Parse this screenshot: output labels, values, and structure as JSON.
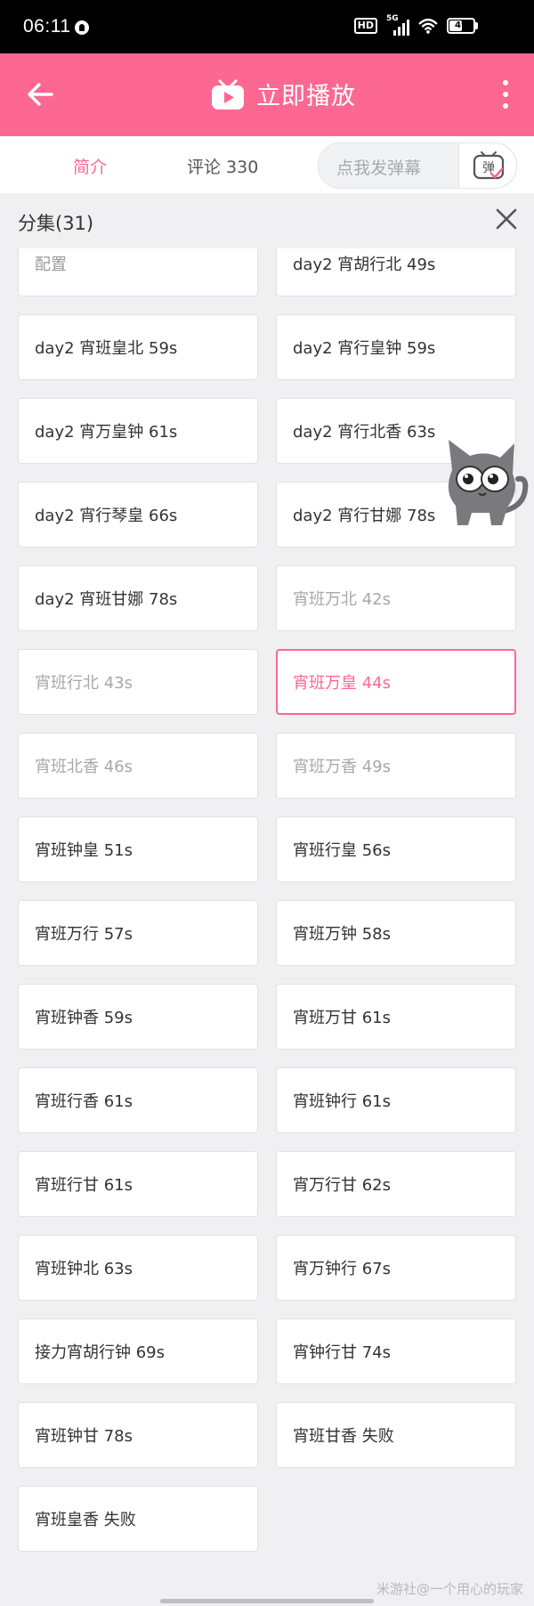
{
  "status_bar": {
    "time": "06:11",
    "hd": "HD",
    "network": "5G",
    "battery": "49",
    "battery_level": 0.49
  },
  "top_bar": {
    "title": "立即播放",
    "color": "#fc6891"
  },
  "tabs": [
    {
      "label": "简介",
      "active": true
    },
    {
      "label": "评论 330",
      "active": false
    }
  ],
  "danmaku": {
    "placeholder": "点我发弹幕",
    "button_glyph": "弹"
  },
  "episode_panel": {
    "title": "分集(31)",
    "episodes": [
      {
        "label": "配置",
        "state": "dim"
      },
      {
        "label": "day2 宵胡行北 49s",
        "state": "normal"
      },
      {
        "label": "day2 宵班皇北 59s",
        "state": "normal"
      },
      {
        "label": "day2 宵行皇钟 59s",
        "state": "normal"
      },
      {
        "label": "day2 宵万皇钟 61s",
        "state": "normal"
      },
      {
        "label": "day2 宵行北香 63s",
        "state": "normal"
      },
      {
        "label": "day2 宵行琴皇 66s",
        "state": "normal"
      },
      {
        "label": "day2 宵行甘娜 78s",
        "state": "normal"
      },
      {
        "label": "day2 宵班甘娜 78s",
        "state": "normal"
      },
      {
        "label": "宵班万北 42s",
        "state": "watched"
      },
      {
        "label": "宵班行北 43s",
        "state": "watched"
      },
      {
        "label": "宵班万皇 44s",
        "state": "current"
      },
      {
        "label": "宵班北香 46s",
        "state": "watched"
      },
      {
        "label": "宵班万香 49s",
        "state": "watched"
      },
      {
        "label": "宵班钟皇 51s",
        "state": "normal"
      },
      {
        "label": "宵班行皇 56s",
        "state": "normal"
      },
      {
        "label": "宵班万行 57s",
        "state": "normal"
      },
      {
        "label": "宵班万钟 58s",
        "state": "normal"
      },
      {
        "label": "宵班钟香 59s",
        "state": "normal"
      },
      {
        "label": "宵班万甘 61s",
        "state": "normal"
      },
      {
        "label": "宵班行香 61s",
        "state": "normal"
      },
      {
        "label": "宵班钟行 61s",
        "state": "normal"
      },
      {
        "label": "宵班行甘 61s",
        "state": "normal"
      },
      {
        "label": "宵万行甘 62s",
        "state": "normal"
      },
      {
        "label": "宵班钟北 63s",
        "state": "normal"
      },
      {
        "label": "宵万钟行 67s",
        "state": "normal"
      },
      {
        "label": "接力宵胡行钟 69s",
        "state": "normal"
      },
      {
        "label": "宵钟行甘 74s",
        "state": "normal"
      },
      {
        "label": "宵班钟甘 78s",
        "state": "normal"
      },
      {
        "label": "宵班甘香 失败",
        "state": "normal"
      },
      {
        "label": "宵班皇香 失败",
        "state": "normal"
      }
    ]
  },
  "watermark": "米游社@一个用心的玩家"
}
